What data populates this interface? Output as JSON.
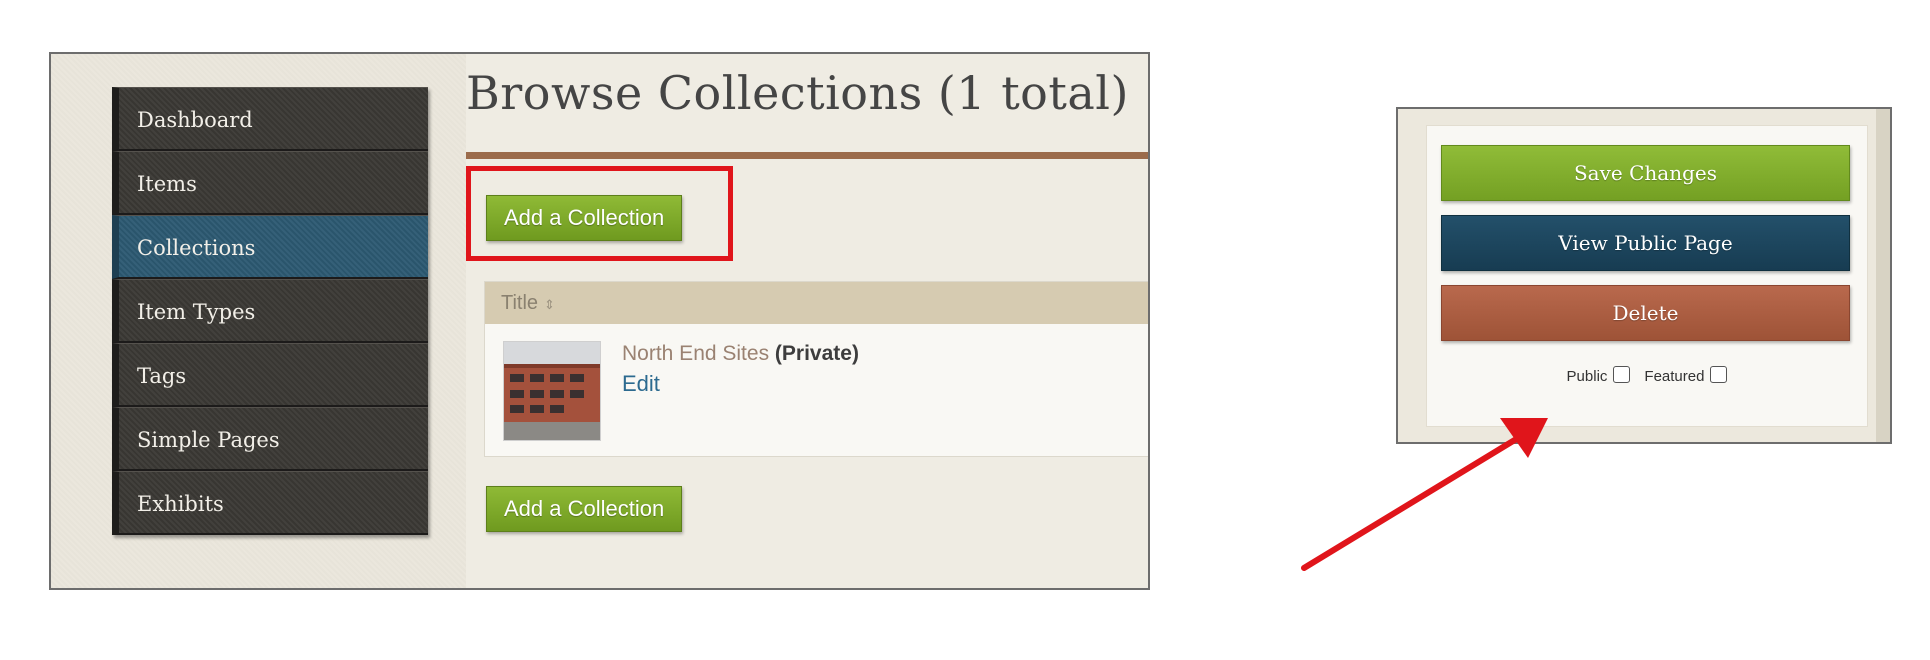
{
  "admin": {
    "nav_items": [
      {
        "label": "Dashboard",
        "active": false
      },
      {
        "label": "Items",
        "active": false
      },
      {
        "label": "Collections",
        "active": true
      },
      {
        "label": "Item Types",
        "active": false
      },
      {
        "label": "Tags",
        "active": false
      },
      {
        "label": "Simple Pages",
        "active": false
      },
      {
        "label": "Exhibits",
        "active": false
      }
    ],
    "page_title": "Browse Collections (1 total)",
    "add_collection_label": "Add a Collection",
    "table": {
      "header_title": "Title",
      "sort_icon": "⇕",
      "rows": [
        {
          "title": "North End Sites",
          "status": "(Private)",
          "edit_label": "Edit"
        }
      ]
    }
  },
  "edit_panel": {
    "save_label": "Save Changes",
    "view_label": "View Public Page",
    "delete_label": "Delete",
    "public_label": "Public",
    "featured_label": "Featured",
    "public_checked": false,
    "featured_checked": false
  },
  "colors": {
    "highlight": "#e0151b",
    "arrow": "#e0151b",
    "green_button": "#7ca826",
    "blue_button": "#1d465e",
    "delete_button": "#ad5f43",
    "sidebar": "#3b3935",
    "sidebar_active": "#2d5a73"
  },
  "icons": [
    "sort-icon",
    "annotation-arrow",
    "building-thumbnail"
  ]
}
